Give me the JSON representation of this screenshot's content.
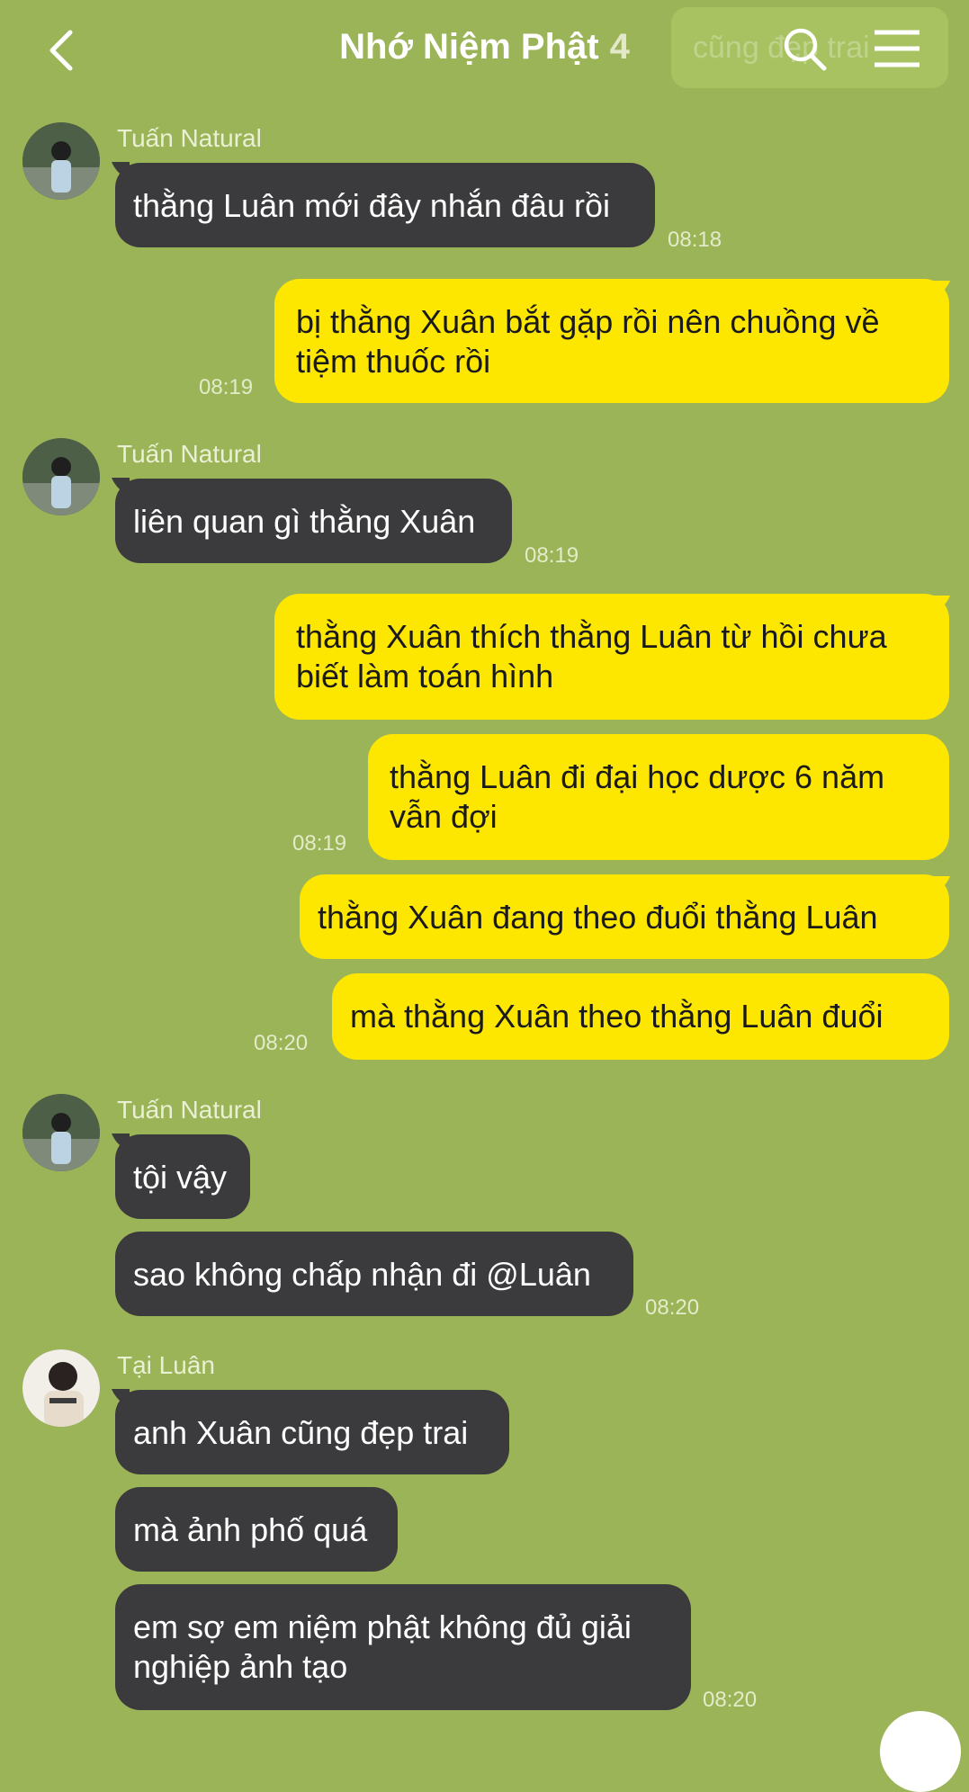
{
  "header": {
    "back_icon": "chevron-left-icon",
    "title": "Nhớ Niệm Phật",
    "member_count": "4",
    "search_ghost_text": "cũng  đẹp trai",
    "search_icon": "search-icon",
    "menu_icon": "menu-icon"
  },
  "messages": [
    {
      "sender": "Tuấn Natural",
      "text": "thằng Luân mới đây nhắn đâu rồi",
      "time": "08:18"
    },
    {
      "text_line1": "bị thằng Xuân bắt gặp rồi nên chuồng về",
      "text_line2": "tiệm thuốc rồi",
      "time": "08:19"
    },
    {
      "sender": "Tuấn Natural",
      "text": "liên quan gì thằng Xuân",
      "time": "08:19"
    },
    {
      "text_line1": "thằng Xuân thích thằng Luân từ hồi chưa",
      "text_line2": "biết làm toán hình"
    },
    {
      "text_line1": "thằng Luân đi đại học dược 6 năm",
      "text_line2": "vẫn đợi",
      "time": "08:19"
    },
    {
      "text": "thằng Xuân đang theo đuổi thằng Luân"
    },
    {
      "text": "mà thằng Xuân theo thằng Luân đuổi",
      "time": "08:20"
    },
    {
      "sender": "Tuấn Natural",
      "text": "tội vậy"
    },
    {
      "text": "sao không chấp nhận đi @Luân",
      "time": "08:20"
    },
    {
      "sender": "Tại Luân",
      "text": "anh Xuân cũng đẹp trai"
    },
    {
      "text": "mà ảnh phố quá"
    },
    {
      "text_line1": "em sợ em niệm phật không đủ giải",
      "text_line2": "nghiệp ảnh tạo",
      "time": "08:20"
    }
  ],
  "colors": {
    "background": "#9cb458",
    "incoming_bubble": "#3b3b3d",
    "outgoing_bubble": "#fde600"
  }
}
